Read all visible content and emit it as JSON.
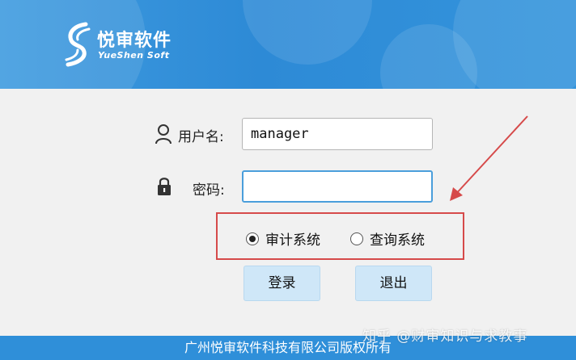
{
  "brand": {
    "name_cn": "悦审软件",
    "name_en": "YueShen Soft"
  },
  "login": {
    "username_label": "用户名:",
    "username_value": "manager",
    "password_label": "密码:",
    "password_value": "",
    "system_options": [
      {
        "label": "审计系统",
        "selected": true
      },
      {
        "label": "查询系统",
        "selected": false
      }
    ],
    "login_button": "登录",
    "exit_button": "退出"
  },
  "footer": {
    "copyright": "广州悦审软件科技有限公司版权所有"
  },
  "watermark": "知乎 @财审知识与求教事",
  "colors": {
    "header_blue": "#2d8ad6",
    "highlight_red": "#d64a4a",
    "button_bg": "#cfe7f8"
  },
  "icons": {
    "user": "user-icon",
    "lock": "lock-icon",
    "logo": "yueshen-logo-icon"
  }
}
